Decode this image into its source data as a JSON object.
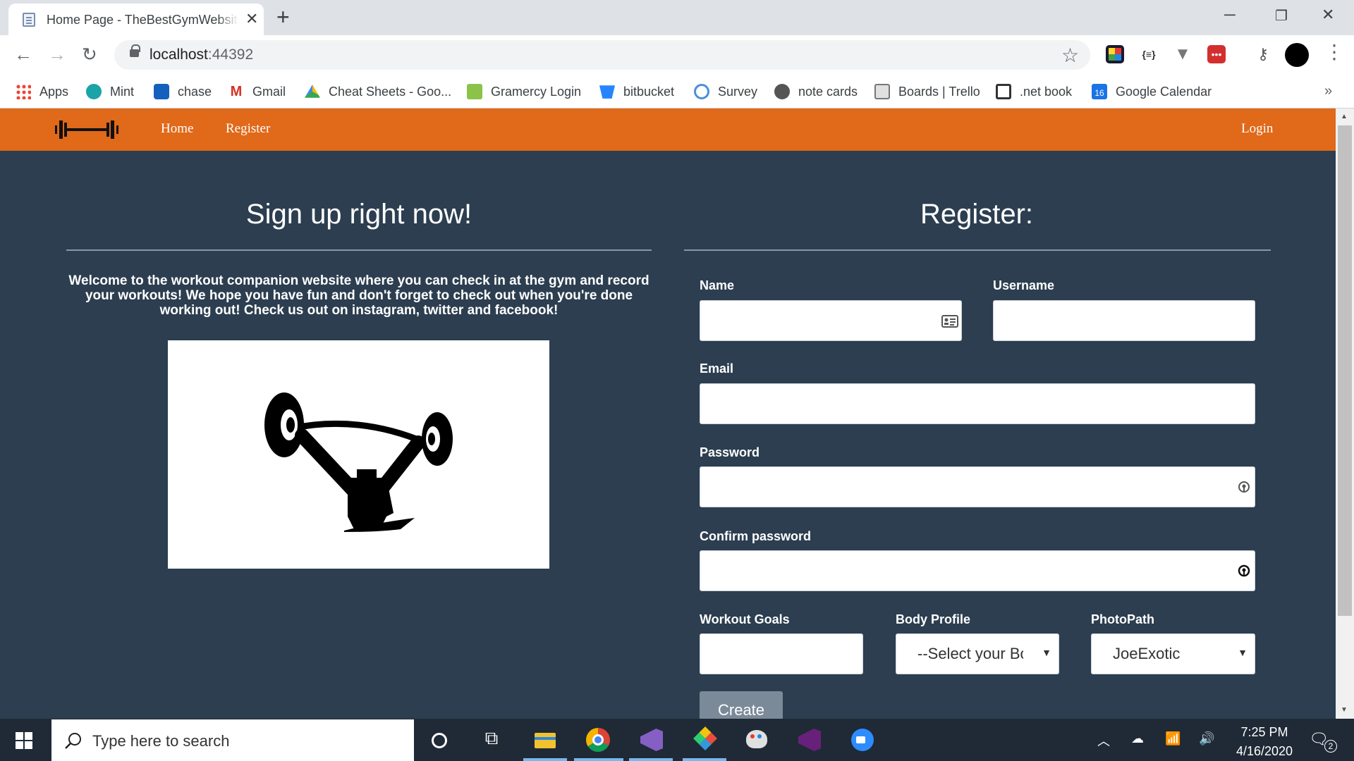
{
  "browser": {
    "tab_title": "Home Page - TheBestGymWebsite",
    "url_host": "localhost",
    "url_port": ":44392",
    "bookmarks": [
      {
        "label": "Apps",
        "icon": "apps-grid-icon"
      },
      {
        "label": "Mint",
        "icon": "mint-icon"
      },
      {
        "label": "chase",
        "icon": "chase-icon"
      },
      {
        "label": "Gmail",
        "icon": "gmail-icon"
      },
      {
        "label": "Cheat Sheets - Goo...",
        "icon": "google-drive-icon"
      },
      {
        "label": "Gramercy Login",
        "icon": "building-icon"
      },
      {
        "label": "bitbucket",
        "icon": "bitbucket-icon"
      },
      {
        "label": "Survey",
        "icon": "survey-icon"
      },
      {
        "label": "note cards",
        "icon": "globe-icon"
      },
      {
        "label": "Boards | Trello",
        "icon": "trello-icon"
      },
      {
        "label": ".net book",
        "icon": "book-icon"
      },
      {
        "label": "Google Calendar",
        "icon": "calendar-icon"
      }
    ],
    "calendar_day": "16",
    "more_bookmarks": "»"
  },
  "site": {
    "nav": {
      "home": "Home",
      "register": "Register",
      "login": "Login"
    },
    "left_heading": "Sign up right now!",
    "intro": "Welcome to the workout companion website where you can check in at the gym and record your workouts! We hope you have fun and don't forget to check out when you're done working out! Check us out on instagram, twitter and facebook!",
    "right_heading": "Register:"
  },
  "form": {
    "name_label": "Name",
    "username_label": "Username",
    "email_label": "Email",
    "password_label": "Password",
    "confirm_label": "Confirm password",
    "goals_label": "Workout Goals",
    "body_label": "Body Profile",
    "photo_label": "PhotoPath",
    "body_selected": "--Select your Body Profile--",
    "photo_selected": "JoeExotic",
    "create_label": "Create"
  },
  "taskbar": {
    "search_placeholder": "Type here to search",
    "time": "7:25 PM",
    "date": "4/16/2020",
    "notification_count": "2"
  }
}
